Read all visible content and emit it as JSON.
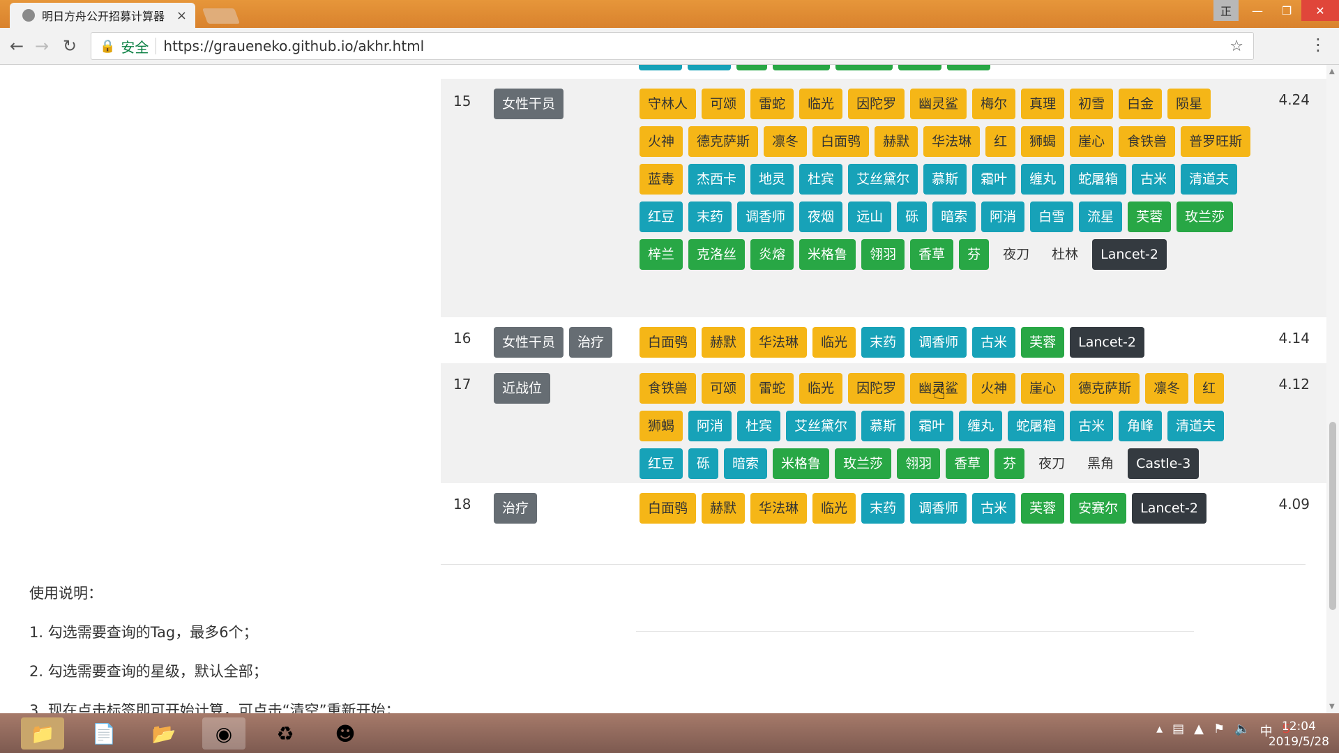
{
  "browser": {
    "tab_title": "明日方舟公开招募计算器",
    "tab_close": "×",
    "secure_label": "安全",
    "url": "https://graueneko.github.io/akhr.html",
    "window_ime": "正"
  },
  "results": [
    {
      "index": "15",
      "tags": [
        "女性干员"
      ],
      "score": "4.24",
      "operators": [
        {
          "name": "守林人",
          "rarity": 5
        },
        {
          "name": "可颂",
          "rarity": 5
        },
        {
          "name": "雷蛇",
          "rarity": 5
        },
        {
          "name": "临光",
          "rarity": 5
        },
        {
          "name": "因陀罗",
          "rarity": 5
        },
        {
          "name": "幽灵鲨",
          "rarity": 5
        },
        {
          "name": "梅尔",
          "rarity": 5
        },
        {
          "name": "真理",
          "rarity": 5
        },
        {
          "name": "初雪",
          "rarity": 5
        },
        {
          "name": "白金",
          "rarity": 5
        },
        {
          "name": "陨星",
          "rarity": 5
        },
        {
          "name": "火神",
          "rarity": 5
        },
        {
          "name": "德克萨斯",
          "rarity": 5
        },
        {
          "name": "凛冬",
          "rarity": 5
        },
        {
          "name": "白面鸮",
          "rarity": 5
        },
        {
          "name": "赫默",
          "rarity": 5
        },
        {
          "name": "华法琳",
          "rarity": 5
        },
        {
          "name": "红",
          "rarity": 5
        },
        {
          "name": "狮蝎",
          "rarity": 5
        },
        {
          "name": "崖心",
          "rarity": 5
        },
        {
          "name": "食铁兽",
          "rarity": 5
        },
        {
          "name": "普罗旺斯",
          "rarity": 5
        },
        {
          "name": "蓝毒",
          "rarity": 5
        },
        {
          "name": "杰西卡",
          "rarity": 4
        },
        {
          "name": "地灵",
          "rarity": 4
        },
        {
          "name": "杜宾",
          "rarity": 4
        },
        {
          "name": "艾丝黛尔",
          "rarity": 4
        },
        {
          "name": "慕斯",
          "rarity": 4
        },
        {
          "name": "霜叶",
          "rarity": 4
        },
        {
          "name": "缠丸",
          "rarity": 4
        },
        {
          "name": "蛇屠箱",
          "rarity": 4
        },
        {
          "name": "古米",
          "rarity": 4
        },
        {
          "name": "清道夫",
          "rarity": 4
        },
        {
          "name": "红豆",
          "rarity": 4
        },
        {
          "name": "末药",
          "rarity": 4
        },
        {
          "name": "调香师",
          "rarity": 4
        },
        {
          "name": "夜烟",
          "rarity": 4
        },
        {
          "name": "远山",
          "rarity": 4
        },
        {
          "name": "砾",
          "rarity": 4
        },
        {
          "name": "暗索",
          "rarity": 4
        },
        {
          "name": "阿消",
          "rarity": 4
        },
        {
          "name": "白雪",
          "rarity": 4
        },
        {
          "name": "流星",
          "rarity": 4
        },
        {
          "name": "芙蓉",
          "rarity": 3
        },
        {
          "name": "玫兰莎",
          "rarity": 3
        },
        {
          "name": "梓兰",
          "rarity": 3
        },
        {
          "name": "克洛丝",
          "rarity": 3
        },
        {
          "name": "炎熔",
          "rarity": 3
        },
        {
          "name": "米格鲁",
          "rarity": 3
        },
        {
          "name": "翎羽",
          "rarity": 3
        },
        {
          "name": "香草",
          "rarity": 3
        },
        {
          "name": "芬",
          "rarity": 3
        },
        {
          "name": "夜刀",
          "rarity": 2
        },
        {
          "name": "杜林",
          "rarity": 2
        },
        {
          "name": "Lancet-2",
          "rarity": 1
        }
      ]
    },
    {
      "index": "16",
      "tags": [
        "女性干员",
        "治疗"
      ],
      "score": "4.14",
      "operators": [
        {
          "name": "白面鸮",
          "rarity": 5
        },
        {
          "name": "赫默",
          "rarity": 5
        },
        {
          "name": "华法琳",
          "rarity": 5
        },
        {
          "name": "临光",
          "rarity": 5
        },
        {
          "name": "末药",
          "rarity": 4
        },
        {
          "name": "调香师",
          "rarity": 4
        },
        {
          "name": "古米",
          "rarity": 4
        },
        {
          "name": "芙蓉",
          "rarity": 3
        },
        {
          "name": "Lancet-2",
          "rarity": 1
        }
      ]
    },
    {
      "index": "17",
      "tags": [
        "近战位"
      ],
      "score": "4.12",
      "operators": [
        {
          "name": "食铁兽",
          "rarity": 5
        },
        {
          "name": "可颂",
          "rarity": 5
        },
        {
          "name": "雷蛇",
          "rarity": 5
        },
        {
          "name": "临光",
          "rarity": 5
        },
        {
          "name": "因陀罗",
          "rarity": 5
        },
        {
          "name": "幽灵鲨",
          "rarity": 5
        },
        {
          "name": "火神",
          "rarity": 5
        },
        {
          "name": "崖心",
          "rarity": 5
        },
        {
          "name": "德克萨斯",
          "rarity": 5
        },
        {
          "name": "凛冬",
          "rarity": 5
        },
        {
          "name": "红",
          "rarity": 5
        },
        {
          "name": "狮蝎",
          "rarity": 5
        },
        {
          "name": "阿消",
          "rarity": 4
        },
        {
          "name": "杜宾",
          "rarity": 4
        },
        {
          "name": "艾丝黛尔",
          "rarity": 4
        },
        {
          "name": "慕斯",
          "rarity": 4
        },
        {
          "name": "霜叶",
          "rarity": 4
        },
        {
          "name": "缠丸",
          "rarity": 4
        },
        {
          "name": "蛇屠箱",
          "rarity": 4
        },
        {
          "name": "古米",
          "rarity": 4
        },
        {
          "name": "角峰",
          "rarity": 4
        },
        {
          "name": "清道夫",
          "rarity": 4
        },
        {
          "name": "红豆",
          "rarity": 4
        },
        {
          "name": "砾",
          "rarity": 4
        },
        {
          "name": "暗索",
          "rarity": 4
        },
        {
          "name": "米格鲁",
          "rarity": 3
        },
        {
          "name": "玫兰莎",
          "rarity": 3
        },
        {
          "name": "翎羽",
          "rarity": 3
        },
        {
          "name": "香草",
          "rarity": 3
        },
        {
          "name": "芬",
          "rarity": 3
        },
        {
          "name": "夜刀",
          "rarity": 2
        },
        {
          "name": "黑角",
          "rarity": 2
        },
        {
          "name": "Castle-3",
          "rarity": 1
        }
      ]
    },
    {
      "index": "18",
      "tags": [
        "治疗"
      ],
      "score": "4.09",
      "operators": [
        {
          "name": "白面鸮",
          "rarity": 5
        },
        {
          "name": "赫默",
          "rarity": 5
        },
        {
          "name": "华法琳",
          "rarity": 5
        },
        {
          "name": "临光",
          "rarity": 5
        },
        {
          "name": "末药",
          "rarity": 4
        },
        {
          "name": "调香师",
          "rarity": 4
        },
        {
          "name": "古米",
          "rarity": 4
        },
        {
          "name": "芙蓉",
          "rarity": 3
        },
        {
          "name": "安赛尔",
          "rarity": 3
        },
        {
          "name": "Lancet-2",
          "rarity": 1
        }
      ]
    }
  ],
  "instructions": {
    "title": "使用说明：",
    "step1": "1. 勾选需要查询的Tag，最多6个；",
    "step2": "2. 勾选需要查询的星级，默认全部；",
    "step3": "3. 现在点击标签即可开始计算，可点击“清空”重新开始；"
  },
  "taskbar": {
    "time": "12:04",
    "date": "2019/5/28",
    "ime": "中"
  },
  "colors": {
    "rarity5": "#f5b617",
    "rarity4": "#17a2b8",
    "rarity3": "#28a745",
    "rarity1": "#343a40",
    "tag": "#666d73"
  }
}
